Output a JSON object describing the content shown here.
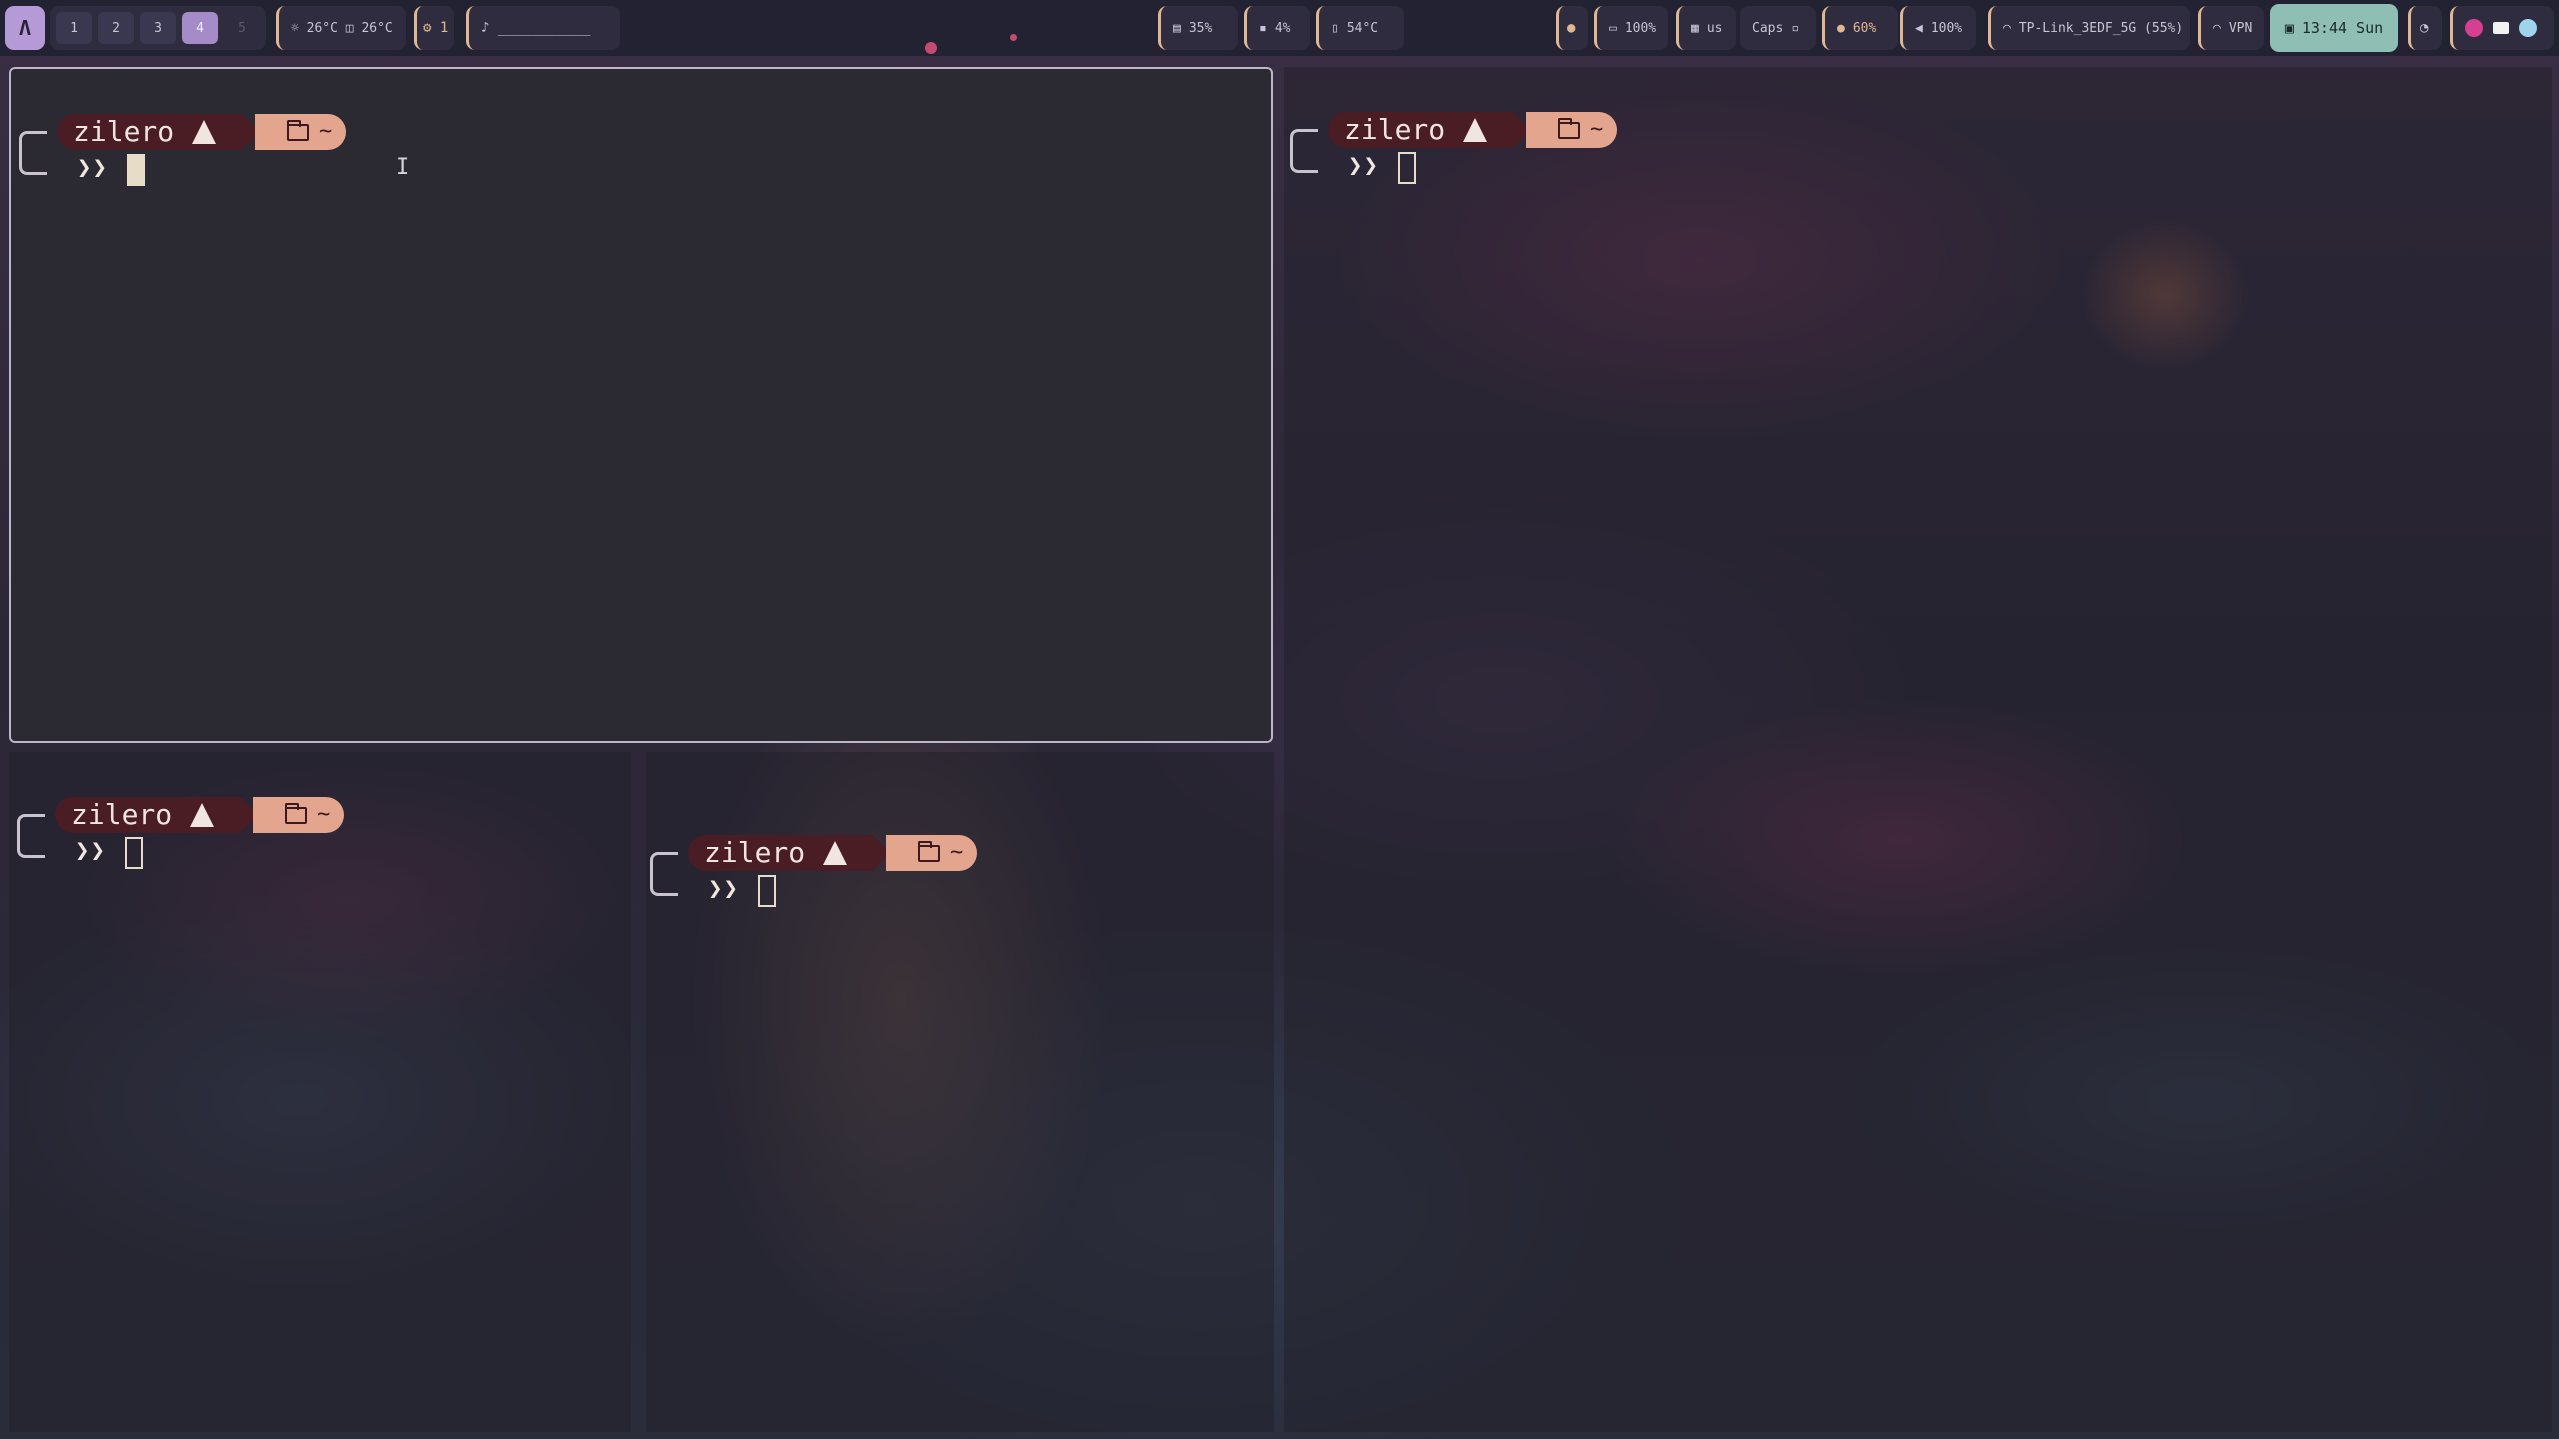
{
  "topbar": {
    "logo_label": "Λ",
    "workspaces": [
      "1",
      "2",
      "3",
      "4",
      "5"
    ],
    "active_workspace": "4",
    "temps": "☼ 26°C  ◫ 26°C",
    "updates": "⚙ 1",
    "music": "♪ ___________",
    "memory": "35%",
    "cpu": "4%",
    "cpu_temp": "54°C",
    "battery": "100%",
    "keyboard_layout": "us",
    "caps": "Caps",
    "brightness": "60%",
    "volume": "100%",
    "wifi": "TP-Link_3EDF_5G (55%)",
    "vpn": "VPN",
    "clock": "13:44 Sun"
  },
  "terminals": [
    {
      "user": "zilero",
      "dir": "~",
      "prompt": "❯❯"
    },
    {
      "user": "zilero",
      "dir": "~",
      "prompt": "❯❯"
    },
    {
      "user": "zilero",
      "dir": "~",
      "prompt": "❯❯"
    },
    {
      "user": "zilero",
      "dir": "~",
      "prompt": "❯❯"
    }
  ],
  "colors": {
    "accent_purple": "#a58cc8",
    "clock_bg": "#8fbfb4",
    "prompt_user_bg": "#4a1c24",
    "prompt_dir_bg": "#e3a58d"
  }
}
